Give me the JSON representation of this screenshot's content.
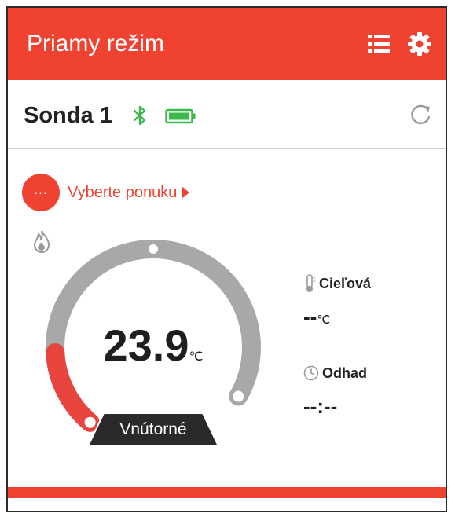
{
  "header": {
    "title": "Priamy režim",
    "list_icon": "list-icon",
    "settings_icon": "gear-icon"
  },
  "device": {
    "name": "Sonda 1",
    "bluetooth_icon": "bluetooth-icon",
    "battery_icon": "battery-full-icon",
    "refresh_icon": "refresh-icon"
  },
  "menu": {
    "icon_text": "···",
    "label": "Vyberte ponuku"
  },
  "gauge": {
    "current_temp": "23.9",
    "unit": "℃",
    "sensor_label": "Vnútorné",
    "fill_fraction": 0.18,
    "flame_icon": "flame-icon"
  },
  "target": {
    "label": "Cieľová",
    "value": "--",
    "unit": "℃",
    "icon": "thermometer-icon"
  },
  "estimate": {
    "label": "Odhad",
    "value": "--:--",
    "icon": "clock-icon"
  },
  "colors": {
    "accent": "#ef4231",
    "ring_track": "#a8a8a8",
    "ring_fill": "#e8453f",
    "bluetooth": "#3cb94a",
    "battery": "#3cb94a",
    "label_bg": "#2a2a2a"
  }
}
